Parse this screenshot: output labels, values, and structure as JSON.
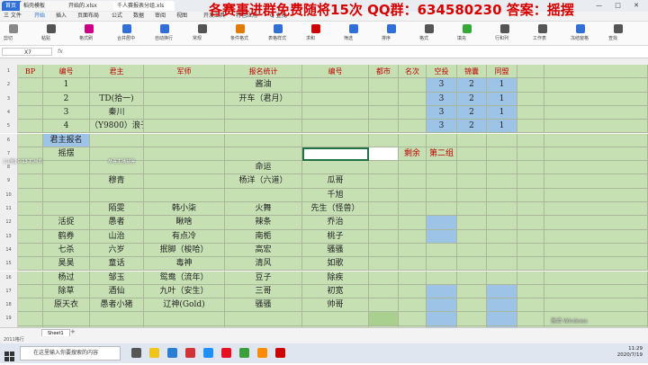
{
  "tabs": {
    "home": "首页",
    "t1": "稻壳模板",
    "t2": "开始的.xlsx",
    "t3": "千人赛报表分组.xls"
  },
  "banner": "各赛事进群免费随将15次 QQ群：634580230 答案：摇摆",
  "menu": [
    "三 文件",
    "开始",
    "插入",
    "页面布局",
    "公式",
    "数据",
    "审阅",
    "视图",
    "开发工具",
    "特色应用",
    "Q 查找"
  ],
  "ribbon_labels": [
    "剪切",
    "粘贴",
    "格式刷",
    "合并居中",
    "自动换行",
    "常规",
    "条件格式",
    "表格样式",
    "求和",
    "筛选",
    "排序",
    "格式",
    "填充",
    "行和列",
    "工作表",
    "冻结窗格",
    "查找"
  ],
  "namebox": "X7",
  "fx": "fx",
  "header": [
    "BP",
    "编号",
    "君主",
    "军师",
    "报名统计",
    "编号",
    "都市",
    "名次",
    "空投",
    "锦囊",
    "同盟"
  ],
  "rows": [
    [
      "",
      "1",
      "",
      "",
      "酱油",
      "",
      "",
      "",
      "3",
      "2",
      "1"
    ],
    [
      "",
      "2",
      "TD(拾一)",
      "",
      "开车（君月）",
      "",
      "",
      "",
      "3",
      "2",
      "1"
    ],
    [
      "",
      "3",
      "秦川",
      "",
      "",
      "",
      "",
      "",
      "3",
      "2",
      "1"
    ],
    [
      "",
      "4",
      "（Y9800）浪子",
      "",
      "",
      "",
      "",
      "",
      "3",
      "2",
      "1"
    ],
    [
      "",
      "君主报名",
      "",
      "",
      "",
      "",
      "",
      "",
      "",
      "",
      ""
    ],
    [
      "",
      "摇摆",
      "",
      "",
      "",
      "",
      "",
      "剩余",
      "第二组",
      "",
      ""
    ],
    [
      "",
      "",
      "",
      "",
      "命运",
      "",
      "",
      "",
      "",
      "",
      ""
    ],
    [
      "",
      "",
      "穆青",
      "",
      "杨洋（六道）",
      "瓜哥",
      "",
      "",
      "",
      "",
      ""
    ],
    [
      "",
      "",
      "",
      "",
      "",
      "千旭",
      "",
      "",
      "",
      "",
      ""
    ],
    [
      "",
      "",
      "陌雯",
      "韩小柒",
      "火舞",
      "先生（怪兽）",
      "",
      "",
      "",
      "",
      ""
    ],
    [
      "",
      "活捉",
      "愚者",
      "瞅啥",
      "辣条",
      "乔治",
      "",
      "",
      "",
      "",
      ""
    ],
    [
      "",
      "鹤券",
      "山治",
      "有点冷",
      "南栀",
      "桃子",
      "",
      "",
      "",
      "",
      ""
    ],
    [
      "",
      "七杀",
      "六岁",
      "抿脚（梭哈）",
      "高宏",
      "骚骚",
      "",
      "",
      "",
      "",
      ""
    ],
    [
      "",
      "昊昊",
      "童话",
      "毒神",
      "清风",
      "如歌",
      "",
      "",
      "",
      "",
      ""
    ],
    [
      "",
      "杨过",
      "邹玉",
      "鸳鸯（流年）",
      "豆子",
      "除疾",
      "",
      "",
      "",
      "",
      ""
    ],
    [
      "",
      "除草",
      "酒仙",
      "九叶（安生）",
      "三哥",
      "初宽",
      "",
      "",
      "",
      "",
      ""
    ],
    [
      "",
      "原天衣",
      "愚者小猪",
      "辽神(Gold)",
      "骚骚",
      "帅哥",
      "",
      "",
      "",
      "",
      ""
    ],
    [
      "",
      "",
      "",
      "",
      "",
      "",
      "",
      "",
      "",
      "",
      ""
    ],
    [
      "",
      "",
      "",
      "",
      "",
      "",
      "",
      "",
      "",
      "",
      ""
    ]
  ],
  "sheet_tab": "Sheet1",
  "status": "2011格行",
  "search_placeholder": "在这里输入你要搜索的内容",
  "clock": {
    "time": "11:29",
    "date": "2020/7/19"
  },
  "watermark": "激活 Windows",
  "overlay_left": "[斗鱼] 0/13 杭州市",
  "overlay_mid": "恭喜主播获得",
  "colors": {
    "green": "#c6e0b4",
    "blue": "#9dc3e6",
    "banner": "#d60000"
  }
}
